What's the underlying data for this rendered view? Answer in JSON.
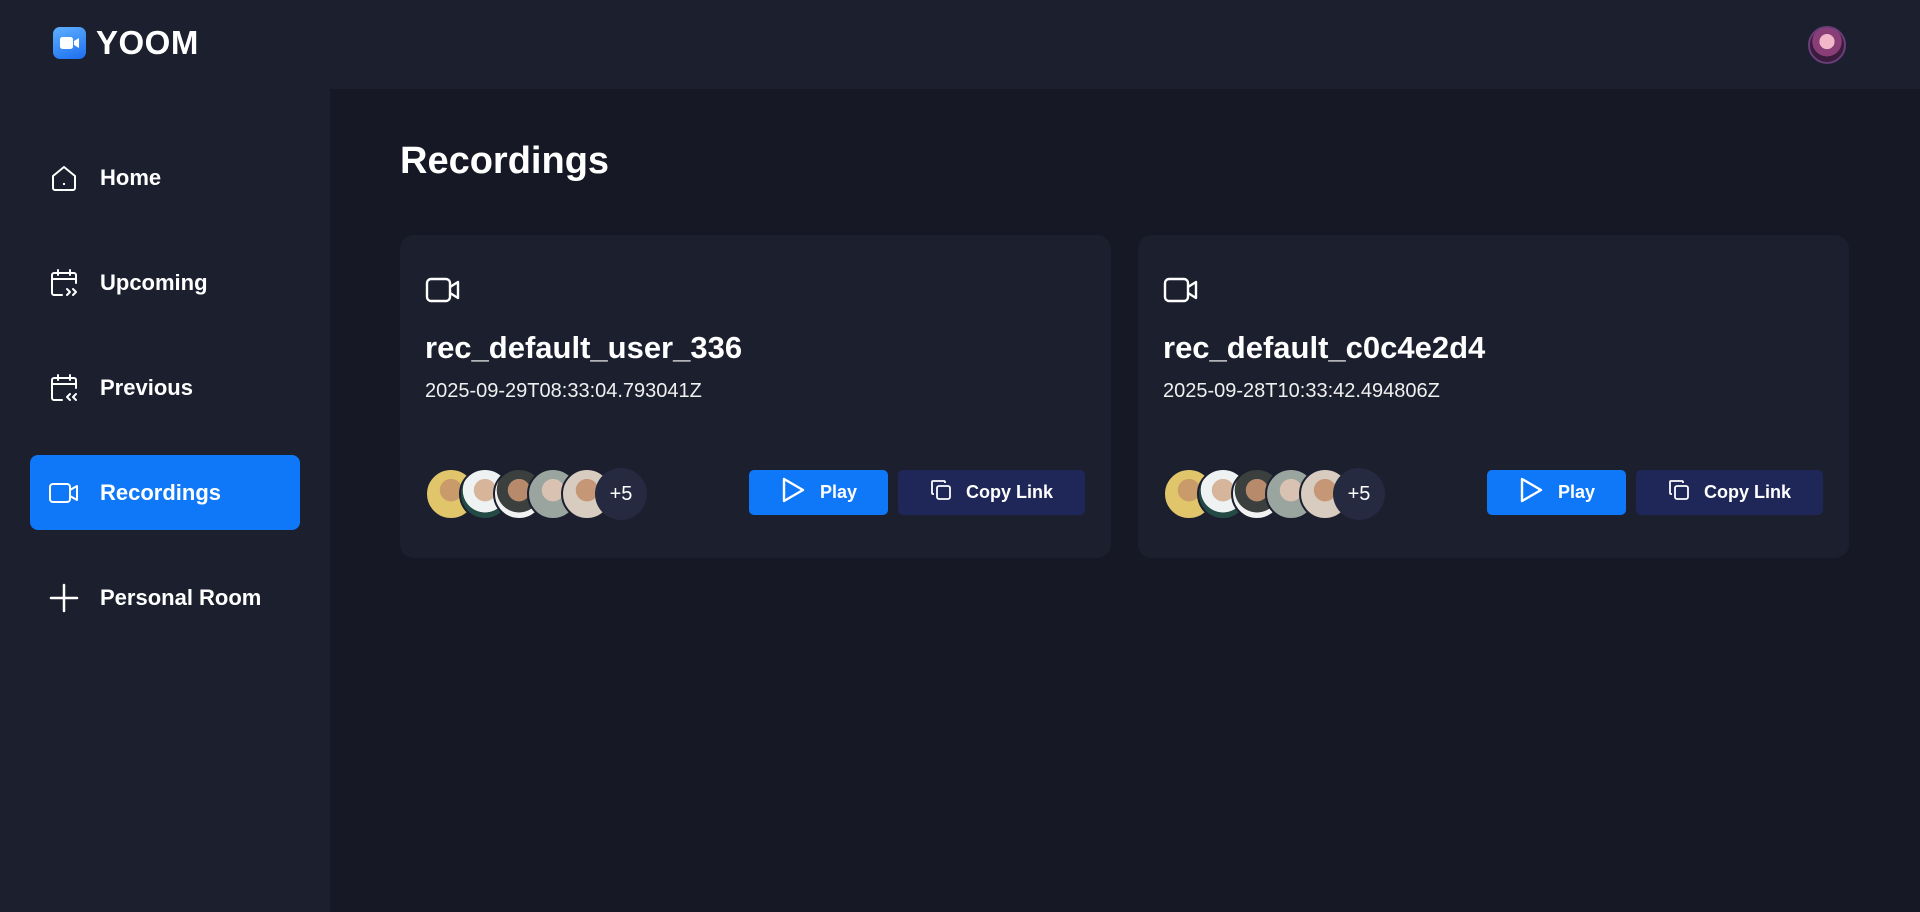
{
  "app": {
    "name": "YOOM"
  },
  "sidebar": {
    "items": [
      {
        "label": "Home",
        "icon": "home-icon",
        "active": false
      },
      {
        "label": "Upcoming",
        "icon": "calendar-forward-icon",
        "active": false
      },
      {
        "label": "Previous",
        "icon": "calendar-back-icon",
        "active": false
      },
      {
        "label": "Recordings",
        "icon": "video-camera-icon",
        "active": true
      },
      {
        "label": "Personal Room",
        "icon": "plus-icon",
        "active": false
      }
    ]
  },
  "main": {
    "title": "Recordings",
    "recordings": [
      {
        "title": "rec_default_user_336",
        "date": "2025-09-29T08:33:04.793041Z",
        "extra_attendees": "+5",
        "play_label": "Play",
        "copy_label": "Copy Link"
      },
      {
        "title": "rec_default_c0c4e2d4",
        "date": "2025-09-28T10:33:42.494806Z",
        "extra_attendees": "+5",
        "play_label": "Play",
        "copy_label": "Copy Link"
      }
    ]
  },
  "colors": {
    "background": "#161925",
    "panel": "#1c1f2e",
    "accent": "#0e78f9",
    "copy_button": "#1e2757"
  }
}
